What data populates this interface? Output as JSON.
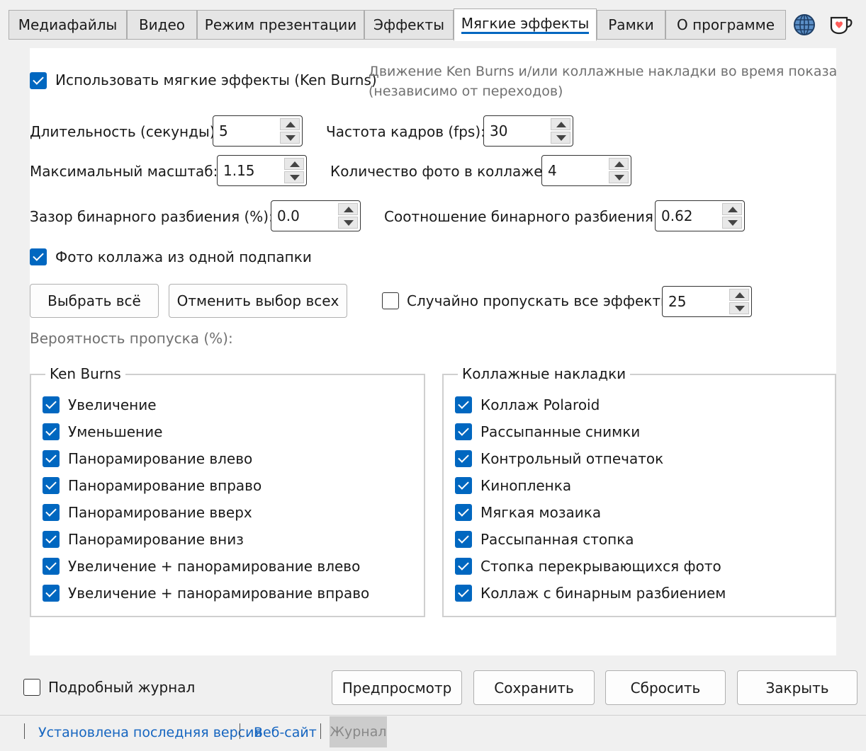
{
  "tabs": [
    {
      "label": "Медиафайлы"
    },
    {
      "label": "Видео"
    },
    {
      "label": "Режим презентации"
    },
    {
      "label": "Эффекты"
    },
    {
      "label": "Мягкие эффекты"
    },
    {
      "label": "Рамки"
    },
    {
      "label": "О программе"
    }
  ],
  "active_tab": "Мягкие эффекты",
  "icons": {
    "globe": "globe-icon",
    "kofi": "kofi-cup-icon"
  },
  "main": {
    "use_soft_effects": {
      "label": "Использовать мягкие эффекты (Ken Burns)",
      "checked": true
    },
    "description_line1": "Движение Ken Burns и/или коллажные накладки во время показа в",
    "description_line2": "(независимо от переходов)",
    "duration": {
      "label": "Длительность (секунды):",
      "value": "5"
    },
    "fps": {
      "label": "Частота кадров (fps):",
      "value": "30"
    },
    "max_scale": {
      "label": "Максимальный масштаб:",
      "value": "1.15"
    },
    "collage_count": {
      "label": "Количество фото в коллаже:",
      "value": "4"
    },
    "binary_gap": {
      "label": "Зазор бинарного разбиения (%):",
      "value": "0.0"
    },
    "binary_ratio": {
      "label": "Соотношение бинарного разбиения:",
      "value": "0.62"
    },
    "same_folder": {
      "label": "Фото коллажа из одной подпапки",
      "checked": true
    },
    "select_all": "Выбрать всё",
    "deselect_all": "Отменить выбор всех",
    "random_skip": {
      "label": "Случайно пропускать все эффекты",
      "checked": false,
      "value": "25"
    },
    "skip_probability_label": "Вероятность пропуска (%):"
  },
  "ken_burns": {
    "title": "Ken Burns",
    "items": [
      {
        "label": "Увеличение",
        "checked": true
      },
      {
        "label": "Уменьшение",
        "checked": true
      },
      {
        "label": "Панорамирование влево",
        "checked": true
      },
      {
        "label": "Панорамирование вправо",
        "checked": true
      },
      {
        "label": "Панорамирование вверх",
        "checked": true
      },
      {
        "label": "Панорамирование вниз",
        "checked": true
      },
      {
        "label": "Увеличение + панорамирование влево",
        "checked": true
      },
      {
        "label": "Увеличение + панорамирование вправо",
        "checked": true
      }
    ]
  },
  "collage": {
    "title": "Коллажные накладки",
    "items": [
      {
        "label": "Коллаж Polaroid",
        "checked": true
      },
      {
        "label": "Рассыпанные снимки",
        "checked": true
      },
      {
        "label": "Контрольный отпечаток",
        "checked": true
      },
      {
        "label": "Кинопленка",
        "checked": true
      },
      {
        "label": "Мягкая мозаика",
        "checked": true
      },
      {
        "label": "Рассыпанная стопка",
        "checked": true
      },
      {
        "label": "Стопка перекрывающихся фото",
        "checked": true
      },
      {
        "label": "Коллаж с бинарным разбиением",
        "checked": true
      }
    ]
  },
  "footer": {
    "verbose_log": {
      "label": "Подробный журнал",
      "checked": false
    },
    "preview": "Предпросмотр",
    "save": "Сохранить",
    "reset": "Сбросить",
    "close": "Закрыть"
  },
  "status": {
    "latest_version": "Установлена последняя версия",
    "website": "Веб-сайт",
    "journal": "Журнал"
  },
  "colors": {
    "accent": "#0067c0",
    "link": "#1565c0"
  }
}
